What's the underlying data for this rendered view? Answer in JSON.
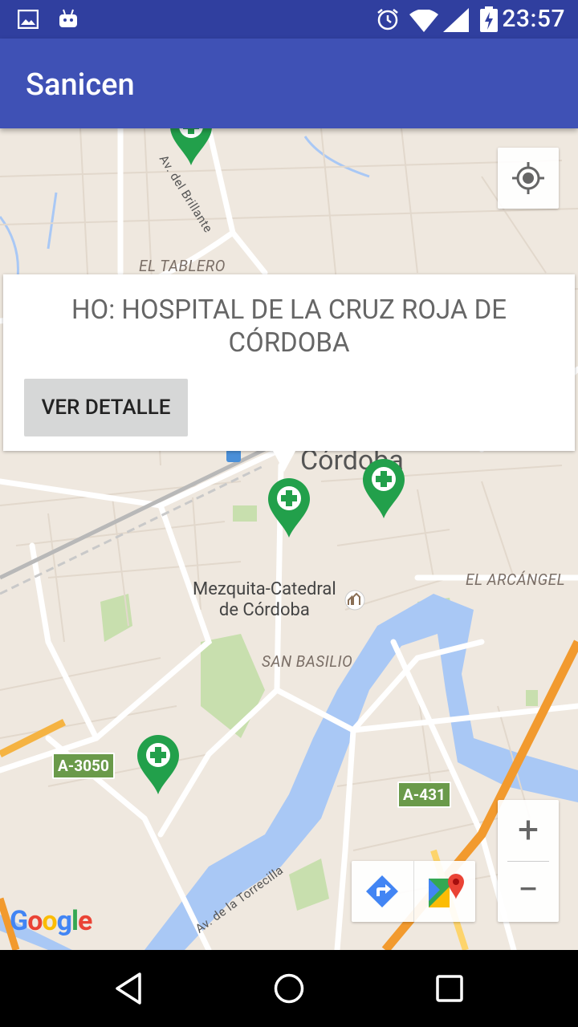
{
  "status_bar": {
    "time": "23:57",
    "icons": [
      "image-icon",
      "android-icon",
      "alarm-icon",
      "wifi-icon",
      "signal-icon",
      "battery-charging-icon"
    ]
  },
  "app_bar": {
    "title": "Sanicen"
  },
  "map": {
    "neighborhood_labels": {
      "el_tablero": "EL TABLERO",
      "el_arcangel": "EL ARCÁNGEL",
      "san_basilio": "SAN BASILIO"
    },
    "street_labels": {
      "brillante": "Av. del Brillante",
      "torrecilla": "Av. de la Torrecilla"
    },
    "city_label": "Córdoba",
    "poi_label": "Mezquita-Catedral\nde Córdoba",
    "road_badges": {
      "a3050": "A-3050",
      "a431": "A-431"
    },
    "google_logo": [
      "G",
      "o",
      "o",
      "g",
      "l",
      "e"
    ],
    "google_colors": [
      "#4285f4",
      "#ea4335",
      "#fbbc05",
      "#4285f4",
      "#34a853",
      "#ea4335"
    ],
    "marker_color": "#22a04b",
    "zoom_in": "+",
    "zoom_out": "−"
  },
  "info_window": {
    "title": "HO:  HOSPITAL DE LA CRUZ ROJA DE CÓRDOBA",
    "button_label": "VER DETALLE"
  }
}
